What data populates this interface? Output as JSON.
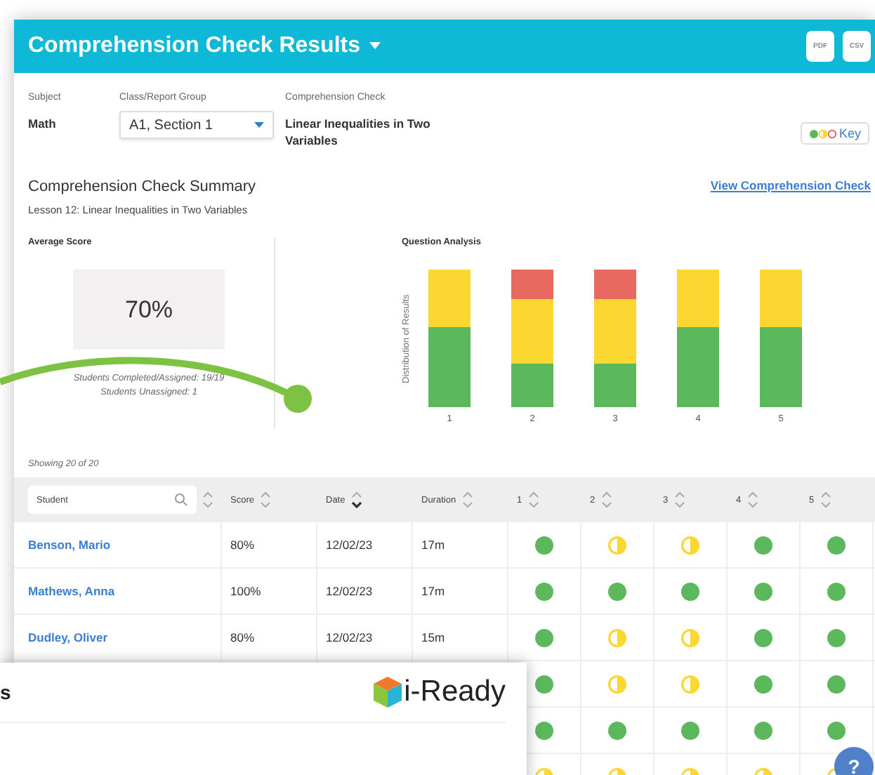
{
  "header": {
    "title": "Comprehension Check Results",
    "exports": [
      "PDF",
      "CSV"
    ]
  },
  "filters": [
    {
      "label": "Subject",
      "value": "Math",
      "kind": "text"
    },
    {
      "label": "Class/Report Group",
      "value": "A1, Section 1",
      "kind": "dropdown"
    },
    {
      "label": "Comprehension Check",
      "value": "Linear Inequalities in Two Variables",
      "kind": "text"
    }
  ],
  "key_button": "Key",
  "summary": {
    "title": "Comprehension Check Summary",
    "subtitle": "Lesson 12: Linear Inequalities in Two Variables",
    "link": "View Comprehension Check"
  },
  "average": {
    "heading": "Average Score",
    "score": "70%",
    "completed": "Students Completed/Assigned: 19/19",
    "unassigned": "Students Unassigned: 1"
  },
  "analysis": {
    "heading": "Question Analysis",
    "ylabel": "Distribution of Results",
    "x_labels": [
      "1",
      "2",
      "3",
      "4",
      "5"
    ]
  },
  "showing": "Showing 20 of 20",
  "table": {
    "search_placeholder": "Student",
    "columns": [
      {
        "label": "Score",
        "sorted": false
      },
      {
        "label": "Date",
        "sorted": true
      },
      {
        "label": "Duration",
        "sorted": false
      },
      {
        "label": "1",
        "sorted": false
      },
      {
        "label": "2",
        "sorted": false
      },
      {
        "label": "3",
        "sorted": false
      },
      {
        "label": "4",
        "sorted": false
      },
      {
        "label": "5",
        "sorted": false
      }
    ],
    "rows": [
      {
        "student": "Benson, Mario",
        "score": "80%",
        "date": "12/02/23",
        "duration": "17m",
        "results": [
          {
            "complete": true
          },
          {
            "complete": false
          },
          {
            "complete": false
          },
          {
            "complete": true
          },
          {
            "complete": true
          }
        ]
      },
      {
        "student": "Mathews, Anna",
        "score": "100%",
        "date": "12/02/23",
        "duration": "17m",
        "results": [
          {
            "complete": true
          },
          {
            "complete": true
          },
          {
            "complete": true
          },
          {
            "complete": true
          },
          {
            "complete": true
          }
        ]
      },
      {
        "student": "Dudley, Oliver",
        "score": "80%",
        "date": "12/02/23",
        "duration": "15m",
        "results": [
          {
            "complete": true
          },
          {
            "complete": false
          },
          {
            "complete": false
          },
          {
            "complete": true
          },
          {
            "complete": true
          }
        ]
      },
      {
        "results": [
          {
            "complete": true
          },
          {
            "complete": false
          },
          {
            "complete": false
          },
          {
            "complete": true
          },
          {
            "complete": true
          }
        ]
      },
      {
        "results": [
          {
            "complete": true
          },
          {
            "complete": true
          },
          {
            "complete": true
          },
          {
            "complete": true
          },
          {
            "complete": true
          }
        ]
      },
      {
        "results": [
          {
            "complete": false
          },
          {
            "complete": false
          },
          {
            "complete": false
          },
          {
            "complete": false
          },
          {
            "complete": false
          }
        ]
      }
    ]
  },
  "overlay": {
    "title_fragment": "s",
    "logo": "i-Ready"
  },
  "help": "?"
}
